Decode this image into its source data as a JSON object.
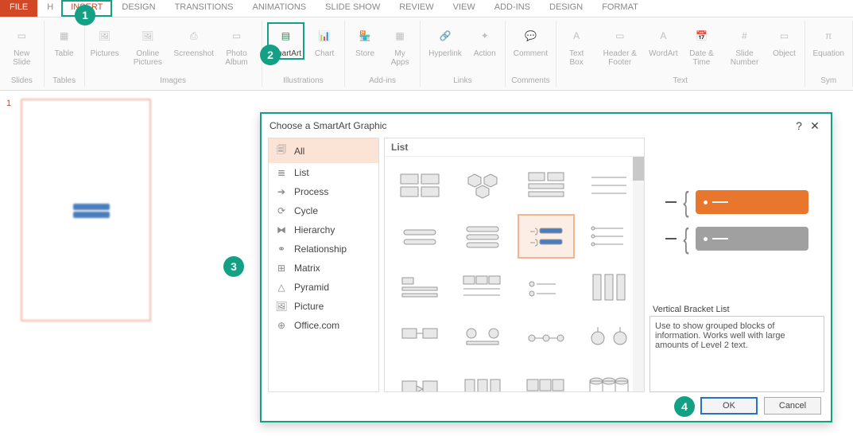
{
  "tabs": {
    "file": "FILE",
    "home": "H",
    "insert": "INSERT",
    "design": "DESIGN",
    "transitions": "TRANSITIONS",
    "animations": "ANIMATIONS",
    "slideshow": "SLIDE SHOW",
    "review": "REVIEW",
    "view": "VIEW",
    "addins": "ADD-INS",
    "design2": "DESIGN",
    "format": "FORMAT"
  },
  "ribbon": {
    "slides": {
      "new_slide": "New Slide",
      "group": "Slides"
    },
    "tables": {
      "table": "Table",
      "group": "Tables"
    },
    "images": {
      "pictures": "Pictures",
      "online": "Online Pictures",
      "screenshot": "Screenshot",
      "album": "Photo Album",
      "group": "Images"
    },
    "illustrations": {
      "smartart": "SmartArt",
      "chart": "Chart",
      "group": "Illustrations"
    },
    "apps": {
      "store": "Store",
      "myapps": "My Apps",
      "group": "Add-ins"
    },
    "links": {
      "hyperlink": "Hyperlink",
      "action": "Action",
      "group": "Links"
    },
    "comments": {
      "comment": "Comment",
      "group": "Comments"
    },
    "text": {
      "textbox": "Text Box",
      "header": "Header & Footer",
      "wordart": "WordArt",
      "datetime": "Date & Time",
      "slidenum": "Slide Number",
      "object": "Object",
      "group": "Text"
    },
    "symbols": {
      "equation": "Equation",
      "group": "Sym"
    }
  },
  "thumb": {
    "num": "1"
  },
  "dialog": {
    "title": "Choose a SmartArt Graphic",
    "help": "?",
    "close": "✕",
    "categories": {
      "all": "All",
      "list": "List",
      "process": "Process",
      "cycle": "Cycle",
      "hierarchy": "Hierarchy",
      "relationship": "Relationship",
      "matrix": "Matrix",
      "pyramid": "Pyramid",
      "picture": "Picture",
      "office": "Office.com"
    },
    "gallery_header": "List",
    "preview": {
      "title": "Vertical Bracket List",
      "desc": "Use to show grouped blocks of information.  Works well with large amounts of Level 2 text."
    },
    "ok": "OK",
    "cancel": "Cancel"
  },
  "callouts": {
    "c1": "1",
    "c2": "2",
    "c3": "3",
    "c4": "4"
  }
}
